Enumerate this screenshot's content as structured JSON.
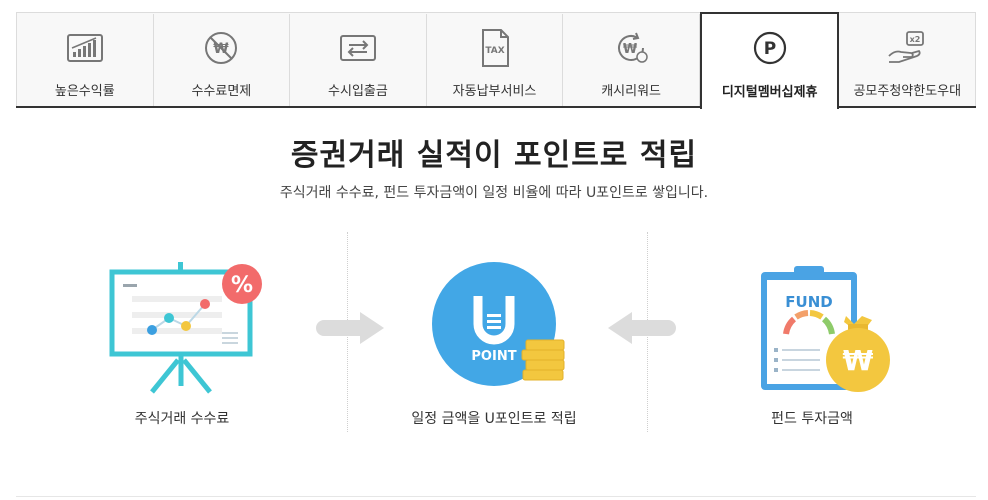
{
  "tabs": [
    {
      "label": "높은수익률",
      "icon": "chart-growth-icon",
      "active": false
    },
    {
      "label": "수수료면제",
      "icon": "no-fee-won-icon",
      "active": false
    },
    {
      "label": "수시입출금",
      "icon": "transfer-arrows-icon",
      "active": false
    },
    {
      "label": "자동납부서비스",
      "icon": "tax-document-icon",
      "active": false
    },
    {
      "label": "캐시리워드",
      "icon": "won-cycle-icon",
      "active": false
    },
    {
      "label": "디지털멤버십제휴",
      "icon": "point-p-icon",
      "active": true
    },
    {
      "label": "공모주청약한도우대",
      "icon": "hand-x2-icon",
      "active": false
    }
  ],
  "main": {
    "title": "증권거래 실적이 포인트로 적립",
    "subtitle": "주식거래 수수료, 펀드 투자금액이 일정 비율에 따라 U포인트로 쌓입니다."
  },
  "steps": {
    "left": {
      "caption": "주식거래 수수료",
      "badge": "%"
    },
    "center": {
      "caption": "일정 금액을 U포인트로 적립",
      "coin_label": "POINT"
    },
    "right": {
      "caption": "펀드 투자금액",
      "board_label": "FUND"
    }
  },
  "colors": {
    "tab_border_active": "#333333",
    "teal": "#3ec6d4",
    "point_blue": "#42a7e6",
    "gold": "#f3c73f",
    "red_badge": "#f26b6b",
    "arrow_gray": "#dcdcdc"
  }
}
